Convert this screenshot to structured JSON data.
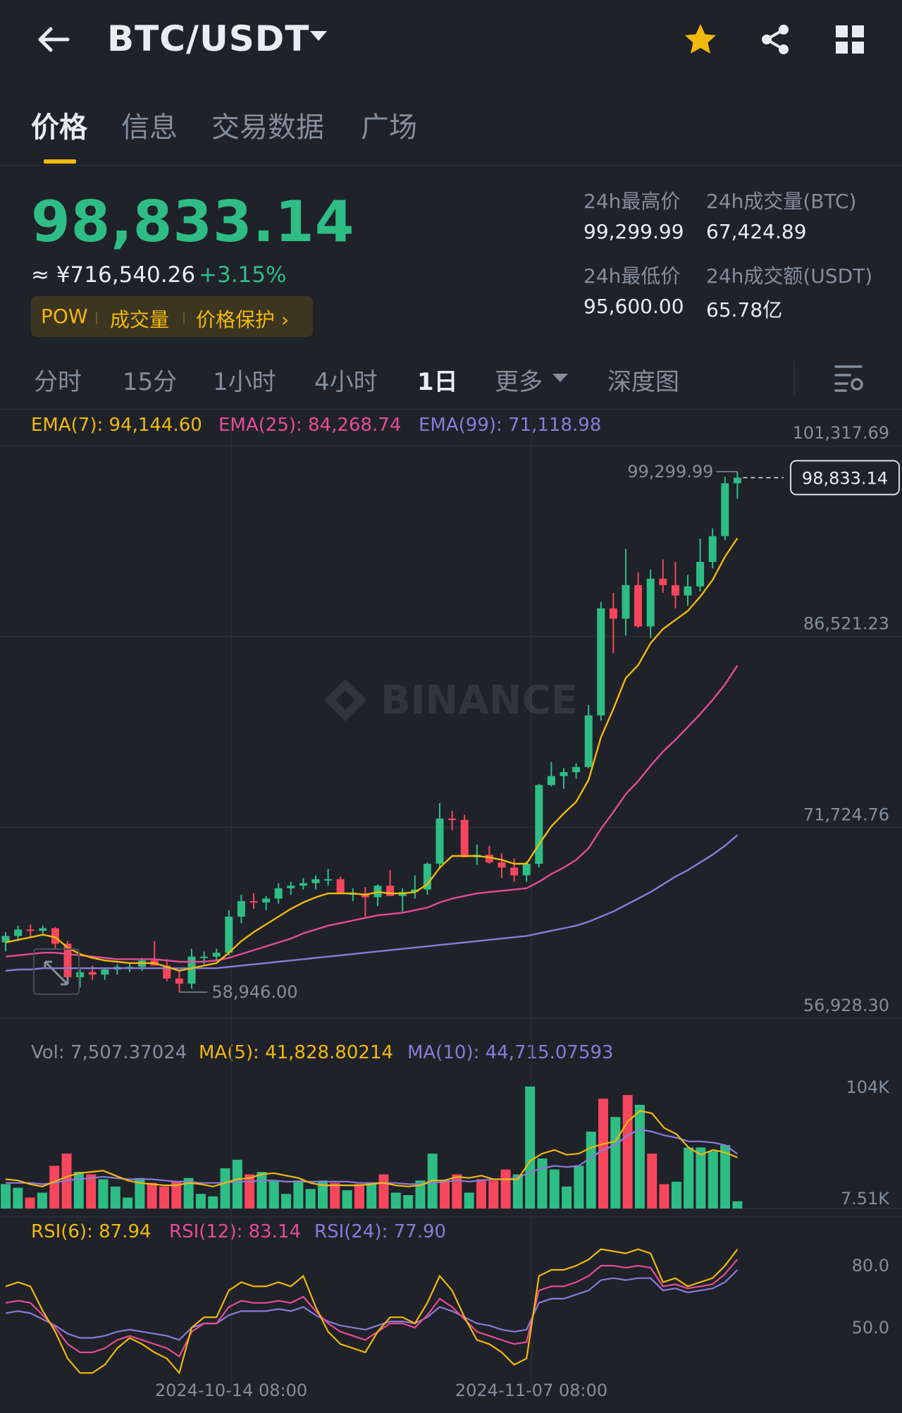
{
  "header": {
    "pair": "BTC/USDT"
  },
  "tabs": [
    {
      "label": "价格"
    },
    {
      "label": "信息"
    },
    {
      "label": "交易数据"
    },
    {
      "label": "广场"
    }
  ],
  "ticker": {
    "price": "98,833.14",
    "cny": "≈ ¥716,540.26",
    "change": "+3.15%",
    "pills": [
      "POW",
      "成交量",
      "价格保护 ›"
    ],
    "stats": [
      {
        "label": "24h最高价",
        "value": "99,299.99"
      },
      {
        "label": "24h成交量(BTC)",
        "value": "67,424.89"
      },
      {
        "label": "24h最低价",
        "value": "95,600.00"
      },
      {
        "label": "24h成交额(USDT)",
        "value": "65.78亿"
      }
    ]
  },
  "intervals": [
    {
      "label": "分时"
    },
    {
      "label": "15分"
    },
    {
      "label": "1小时"
    },
    {
      "label": "4小时"
    },
    {
      "label": "1日"
    },
    {
      "label": "更多"
    },
    {
      "label": "深度图"
    }
  ],
  "legends": {
    "ema": [
      "EMA(7): 94,144.60",
      "EMA(25): 84,268.74",
      "EMA(99): 71,118.98"
    ],
    "vol": [
      "Vol: 7,507.37024",
      "MA(5): 41,828.80214",
      "MA(10): 44,715.07593"
    ],
    "rsi": [
      "RSI(6): 87.94",
      "RSI(12): 83.14",
      "RSI(24): 77.90"
    ]
  },
  "colors": {
    "up": "#2ebd85",
    "down": "#f6465d",
    "ema7": "#f0b90b",
    "ema25": "#e54c96",
    "ema99": "#8c7ad8",
    "bg": "#1f2229"
  },
  "watermark": "BINANCE",
  "chart_data": [
    {
      "type": "candlestick",
      "title": "",
      "x_tick_labels": [
        "2024-10-14 08:00",
        "2024-11-07 08:00"
      ],
      "y_tick_labels": [
        "101,317.69",
        "86,521.23",
        "71,724.76",
        "56,928.30"
      ],
      "ylim": [
        56928.3,
        101317.69
      ],
      "last_price_label": "98,833.14",
      "high_label": "99,299.99",
      "low_label": "58,946.00",
      "candles": [
        {
          "o": 62800,
          "h": 63600,
          "l": 62100,
          "c": 63300
        },
        {
          "o": 63300,
          "h": 64100,
          "l": 62900,
          "c": 63800
        },
        {
          "o": 63800,
          "h": 64200,
          "l": 63200,
          "c": 63700
        },
        {
          "o": 63700,
          "h": 64100,
          "l": 63300,
          "c": 63900
        },
        {
          "o": 63900,
          "h": 64000,
          "l": 62300,
          "c": 62700
        },
        {
          "o": 62700,
          "h": 62900,
          "l": 59600,
          "c": 60100
        },
        {
          "o": 60100,
          "h": 60700,
          "l": 59300,
          "c": 60500
        },
        {
          "o": 60500,
          "h": 61000,
          "l": 59900,
          "c": 60300
        },
        {
          "o": 60300,
          "h": 60800,
          "l": 59900,
          "c": 60700
        },
        {
          "o": 60700,
          "h": 61100,
          "l": 60300,
          "c": 60900
        },
        {
          "o": 60900,
          "h": 61200,
          "l": 60500,
          "c": 60900
        },
        {
          "o": 60900,
          "h": 61600,
          "l": 60600,
          "c": 61400
        },
        {
          "o": 61400,
          "h": 62900,
          "l": 61000,
          "c": 61000
        },
        {
          "o": 61000,
          "h": 61500,
          "l": 59800,
          "c": 60000
        },
        {
          "o": 60000,
          "h": 60600,
          "l": 58946,
          "c": 59600
        },
        {
          "o": 59600,
          "h": 62300,
          "l": 59200,
          "c": 61700
        },
        {
          "o": 61700,
          "h": 62100,
          "l": 61100,
          "c": 61700
        },
        {
          "o": 61700,
          "h": 62300,
          "l": 61400,
          "c": 62000
        },
        {
          "o": 62000,
          "h": 65300,
          "l": 61800,
          "c": 64800
        },
        {
          "o": 64800,
          "h": 66500,
          "l": 64300,
          "c": 66000
        },
        {
          "o": 66000,
          "h": 66600,
          "l": 65400,
          "c": 65900
        },
        {
          "o": 65900,
          "h": 66400,
          "l": 65300,
          "c": 66200
        },
        {
          "o": 66200,
          "h": 67400,
          "l": 65800,
          "c": 67000
        },
        {
          "o": 67000,
          "h": 67500,
          "l": 66500,
          "c": 67200
        },
        {
          "o": 67200,
          "h": 67800,
          "l": 66900,
          "c": 67400
        },
        {
          "o": 67400,
          "h": 68000,
          "l": 66900,
          "c": 67700
        },
        {
          "o": 67700,
          "h": 68500,
          "l": 67200,
          "c": 67700
        },
        {
          "o": 67700,
          "h": 67900,
          "l": 66600,
          "c": 66600
        },
        {
          "o": 66600,
          "h": 67000,
          "l": 66000,
          "c": 66600
        },
        {
          "o": 66600,
          "h": 67100,
          "l": 64800,
          "c": 66300
        },
        {
          "o": 66300,
          "h": 67300,
          "l": 65600,
          "c": 67200
        },
        {
          "o": 67200,
          "h": 68400,
          "l": 66400,
          "c": 66400
        },
        {
          "o": 66400,
          "h": 67000,
          "l": 65200,
          "c": 66700
        },
        {
          "o": 66700,
          "h": 68000,
          "l": 66200,
          "c": 66900
        },
        {
          "o": 66900,
          "h": 69000,
          "l": 66500,
          "c": 68900
        },
        {
          "o": 68900,
          "h": 73600,
          "l": 68500,
          "c": 72400
        },
        {
          "o": 72400,
          "h": 73000,
          "l": 71500,
          "c": 72300
        },
        {
          "o": 72300,
          "h": 72700,
          "l": 69400,
          "c": 69400
        },
        {
          "o": 69400,
          "h": 70400,
          "l": 68800,
          "c": 69600
        },
        {
          "o": 69600,
          "h": 70300,
          "l": 68900,
          "c": 69000
        },
        {
          "o": 69000,
          "h": 69700,
          "l": 67800,
          "c": 68600
        },
        {
          "o": 68600,
          "h": 69300,
          "l": 67500,
          "c": 68000
        },
        {
          "o": 68000,
          "h": 69100,
          "l": 67500,
          "c": 68900
        },
        {
          "o": 68900,
          "h": 75100,
          "l": 68600,
          "c": 75000
        },
        {
          "o": 75000,
          "h": 76800,
          "l": 74900,
          "c": 75700
        },
        {
          "o": 75700,
          "h": 76300,
          "l": 74700,
          "c": 76000
        },
        {
          "o": 76000,
          "h": 76700,
          "l": 75500,
          "c": 76400
        },
        {
          "o": 76400,
          "h": 81200,
          "l": 76300,
          "c": 80400
        },
        {
          "o": 80400,
          "h": 89200,
          "l": 80000,
          "c": 88700
        },
        {
          "o": 88700,
          "h": 89900,
          "l": 85200,
          "c": 87900
        },
        {
          "o": 87900,
          "h": 93300,
          "l": 86600,
          "c": 90500
        },
        {
          "o": 90500,
          "h": 91500,
          "l": 87200,
          "c": 87300
        },
        {
          "o": 87300,
          "h": 91700,
          "l": 86400,
          "c": 91000
        },
        {
          "o": 91000,
          "h": 92500,
          "l": 89900,
          "c": 90500
        },
        {
          "o": 90500,
          "h": 92300,
          "l": 88700,
          "c": 89700
        },
        {
          "o": 89700,
          "h": 91300,
          "l": 88900,
          "c": 90400
        },
        {
          "o": 90400,
          "h": 94100,
          "l": 90000,
          "c": 92300
        },
        {
          "o": 92300,
          "h": 94900,
          "l": 91800,
          "c": 94300
        },
        {
          "o": 94300,
          "h": 98900,
          "l": 94000,
          "c": 98400
        },
        {
          "o": 98400,
          "h": 99300,
          "l": 97200,
          "c": 98833.14
        }
      ],
      "ema7": [
        62800,
        63000,
        63200,
        63400,
        63200,
        62400,
        61900,
        61600,
        61400,
        61300,
        61200,
        61200,
        61200,
        60900,
        60600,
        60800,
        61000,
        61200,
        62000,
        62900,
        63600,
        64200,
        64800,
        65400,
        65900,
        66300,
        66600,
        66600,
        66600,
        66500,
        66700,
        66600,
        66600,
        66700,
        67300,
        68600,
        69500,
        69500,
        69500,
        69400,
        69200,
        68900,
        68900,
        70400,
        71800,
        72800,
        73700,
        75400,
        78700,
        80900,
        83300,
        84300,
        86000,
        87100,
        87800,
        88500,
        89600,
        90900,
        92700,
        94144.6
      ],
      "ema25": [
        61700,
        61800,
        61900,
        62000,
        62000,
        61900,
        61800,
        61700,
        61600,
        61500,
        61500,
        61500,
        61500,
        61400,
        61300,
        61300,
        61300,
        61400,
        61600,
        61900,
        62200,
        62500,
        62800,
        63100,
        63500,
        63800,
        64100,
        64300,
        64500,
        64700,
        64900,
        65000,
        65100,
        65300,
        65500,
        65900,
        66200,
        66400,
        66600,
        66700,
        66800,
        66900,
        67000,
        67500,
        68100,
        68600,
        69200,
        70100,
        71600,
        72900,
        74300,
        75300,
        76500,
        77600,
        78500,
        79500,
        80500,
        81600,
        82800,
        84268.74
      ],
      "ema99": [
        60600,
        60700,
        60700,
        60800,
        60800,
        60800,
        60800,
        60800,
        60800,
        60800,
        60800,
        60800,
        60800,
        60800,
        60800,
        60800,
        60800,
        60800,
        60900,
        61000,
        61100,
        61200,
        61300,
        61400,
        61500,
        61600,
        61700,
        61800,
        61900,
        62000,
        62100,
        62200,
        62300,
        62400,
        62500,
        62600,
        62700,
        62800,
        62900,
        63000,
        63100,
        63200,
        63300,
        63500,
        63700,
        63900,
        64100,
        64400,
        64800,
        65200,
        65700,
        66200,
        66700,
        67300,
        67900,
        68400,
        69000,
        69600,
        70300,
        71118.98
      ]
    },
    {
      "type": "bar",
      "title": "Vol",
      "y_tick_labels": [
        "104K",
        "7.51K"
      ],
      "ylim": [
        0,
        104000
      ],
      "values": [
        20000,
        17000,
        9000,
        13000,
        35000,
        45000,
        30000,
        28000,
        24000,
        18000,
        9000,
        25000,
        21000,
        18000,
        22000,
        25000,
        12000,
        10000,
        33000,
        40000,
        28000,
        30000,
        23000,
        12000,
        23000,
        16000,
        23000,
        21000,
        15000,
        20000,
        21000,
        28000,
        13000,
        11000,
        23000,
        45000,
        23000,
        28000,
        13000,
        24000,
        23000,
        32000,
        28000,
        100000,
        41000,
        32000,
        18000,
        35000,
        63000,
        90000,
        75000,
        93000,
        85000,
        45000,
        20000,
        22000,
        50000,
        50000,
        47000,
        52000,
        6000
      ],
      "ma5": [
        24000,
        23000,
        20000,
        18000,
        22000,
        26000,
        29000,
        30000,
        31000,
        27000,
        23000,
        21000,
        20000,
        19000,
        19000,
        21000,
        20000,
        18000,
        21000,
        24000,
        25000,
        28000,
        29000,
        27000,
        25000,
        21000,
        19000,
        19000,
        19000,
        19000,
        20000,
        21000,
        19000,
        18000,
        19000,
        23000,
        23000,
        26000,
        25000,
        27000,
        24000,
        24000,
        24000,
        39000,
        45000,
        48000,
        44000,
        45000,
        50000,
        53000,
        55000,
        71000,
        80000,
        78000,
        66000,
        61000,
        50000,
        44000,
        48000,
        46000,
        41828.8
      ],
      "ma10": [
        21000,
        21000,
        21000,
        20000,
        21000,
        23000,
        24000,
        25000,
        26000,
        25000,
        24000,
        24000,
        24000,
        23000,
        22000,
        22000,
        21000,
        21000,
        21000,
        22000,
        22000,
        23000,
        23000,
        22000,
        22000,
        22000,
        22000,
        22000,
        22000,
        21000,
        21000,
        21000,
        21000,
        20000,
        20000,
        21000,
        22000,
        23000,
        22000,
        23000,
        24000,
        24000,
        25000,
        30000,
        33000,
        35000,
        34000,
        35000,
        42000,
        48000,
        52000,
        60000,
        65000,
        63000,
        60000,
        58000,
        55000,
        55000,
        54000,
        52000,
        44715.08
      ]
    },
    {
      "type": "line",
      "title": "RSI",
      "y_tick_labels": [
        "80.0",
        "50.0"
      ],
      "ylim": [
        25,
        92
      ],
      "series": [
        {
          "name": "RSI(6)",
          "values": [
            70,
            72,
            70,
            58,
            48,
            35,
            28,
            28,
            32,
            40,
            45,
            42,
            38,
            35,
            28,
            50,
            55,
            55,
            68,
            72,
            70,
            70,
            72,
            70,
            75,
            60,
            48,
            42,
            40,
            38,
            48,
            55,
            55,
            52,
            62,
            75,
            68,
            55,
            44,
            42,
            38,
            32,
            35,
            75,
            78,
            78,
            80,
            83,
            88,
            87,
            86,
            88,
            86,
            72,
            74,
            70,
            72,
            74,
            80,
            87.94
          ]
        },
        {
          "name": "RSI(12)",
          "values": [
            62,
            63,
            62,
            56,
            50,
            42,
            38,
            38,
            40,
            44,
            46,
            44,
            42,
            40,
            36,
            48,
            52,
            52,
            60,
            63,
            62,
            62,
            63,
            62,
            65,
            58,
            52,
            48,
            46,
            44,
            48,
            52,
            52,
            50,
            56,
            64,
            60,
            54,
            48,
            46,
            44,
            42,
            43,
            68,
            70,
            70,
            72,
            75,
            80,
            80,
            79,
            80,
            79,
            70,
            71,
            69,
            70,
            71,
            76,
            83.14
          ]
        },
        {
          "name": "RSI(24)",
          "values": [
            57,
            58,
            57,
            54,
            51,
            47,
            45,
            45,
            46,
            48,
            49,
            48,
            47,
            46,
            44,
            50,
            52,
            52,
            56,
            58,
            58,
            58,
            59,
            58,
            60,
            56,
            53,
            51,
            50,
            49,
            51,
            53,
            53,
            52,
            55,
            60,
            58,
            55,
            52,
            51,
            49,
            48,
            49,
            62,
            64,
            64,
            66,
            68,
            73,
            74,
            73,
            74,
            74,
            68,
            69,
            67,
            68,
            69,
            72,
            77.9
          ]
        }
      ],
      "x_tick_labels": [
        "2024-10-14 08:00",
        "2024-11-07 08:00"
      ]
    }
  ]
}
